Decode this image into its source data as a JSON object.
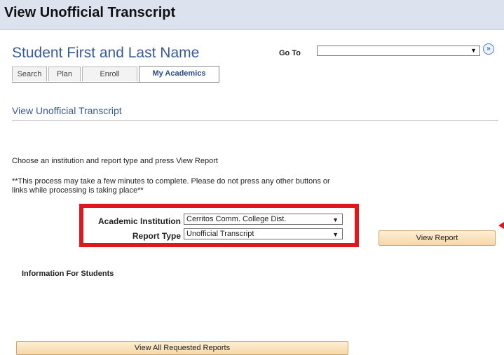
{
  "header": {
    "title": "View Unofficial Transcript"
  },
  "student": {
    "name": "Student First and Last Name"
  },
  "goto": {
    "label": "Go To",
    "value": ""
  },
  "tabs": [
    {
      "label": "Search",
      "active": false
    },
    {
      "label": "Plan",
      "active": false
    },
    {
      "label": "Enroll",
      "active": false
    },
    {
      "label": "My Academics",
      "active": true
    }
  ],
  "section": {
    "title": "View Unofficial Transcript"
  },
  "instructions": "Choose an institution and report type and press View Report",
  "note": "**This process may take a few minutes to complete. Please do not press any other buttons or links while processing is taking place**",
  "form": {
    "institution_label": "Academic Institution",
    "institution_value": "Cerritos Comm. College Dist.",
    "report_type_label": "Report Type",
    "report_type_value": "Unofficial Transcript"
  },
  "buttons": {
    "view_report": "View Report",
    "view_all": "View All Requested Reports"
  },
  "info_heading": "Information For Students",
  "colors": {
    "header_bg": "#dde3ee",
    "title_blue": "#3a5a98",
    "highlight_red": "#e0171e",
    "button_bg": "#f6d8a7"
  }
}
